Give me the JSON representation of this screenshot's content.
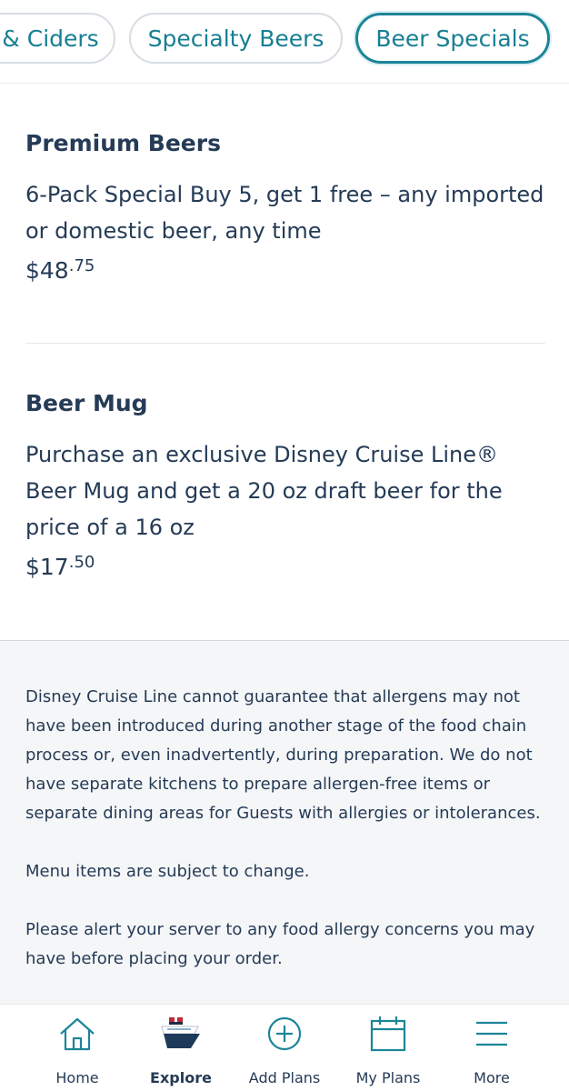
{
  "tabs": [
    {
      "label": "& Ciders"
    },
    {
      "label": "Specialty Beers"
    },
    {
      "label": "Beer Specials"
    }
  ],
  "items": [
    {
      "title": "Premium Beers",
      "description": "6-Pack Special Buy 5, get 1 free – any imported or domestic beer, any time",
      "price_dollars": "$48",
      "price_cents": ".75"
    },
    {
      "title": "Beer Mug",
      "description": "Purchase an exclusive Disney Cruise Line® Beer Mug and get a 20 oz draft beer for the price of a 16 oz",
      "price_dollars": "$17",
      "price_cents": ".50"
    }
  ],
  "disclaimer": {
    "allergen": "Disney Cruise Line cannot guarantee that allergens may not have been introduced during another stage of the food chain process or, even inadvertently, during preparation. We do not have separate kitchens to prepare allergen-free items or separate dining areas for Guests with allergies or intolerances.",
    "change": "Menu items are subject to change.",
    "alert": "Please alert your server to any food allergy concerns you may have before placing your order."
  },
  "nav": {
    "items": [
      {
        "label": "Home",
        "icon": "home-icon"
      },
      {
        "label": "Explore",
        "icon": "ship-icon",
        "active": true
      },
      {
        "label": "Add Plans",
        "icon": "plus-circle-icon"
      },
      {
        "label": "My Plans",
        "icon": "calendar-icon"
      },
      {
        "label": "More",
        "icon": "menu-icon"
      }
    ]
  },
  "colors": {
    "accent": "#1c8598",
    "text": "#253b56",
    "disclaimer_bg": "#f5f6f8"
  }
}
